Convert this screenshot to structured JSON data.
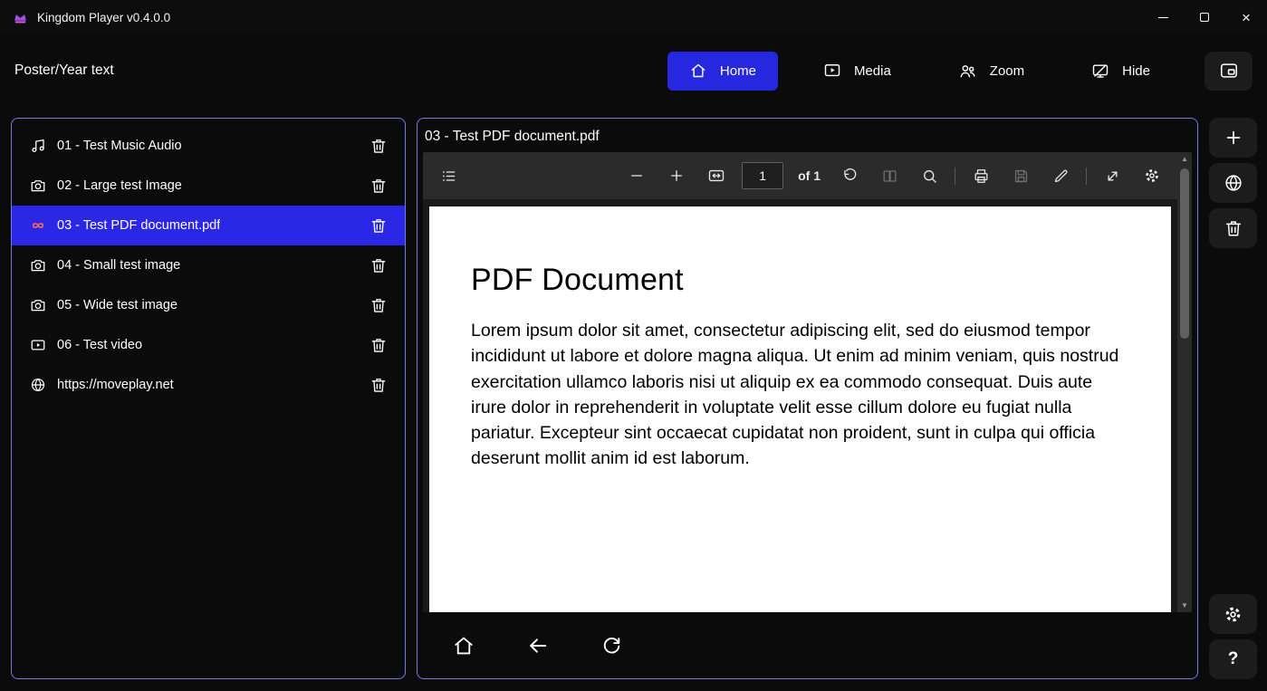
{
  "titlebar": {
    "app_title": "Kingdom Player v0.4.0.0"
  },
  "header": {
    "poster_label": "Poster/Year text",
    "nav": [
      {
        "icon": "home-icon",
        "label": "Home",
        "active": true
      },
      {
        "icon": "media-icon",
        "label": "Media",
        "active": false
      },
      {
        "icon": "zoom-people-icon",
        "label": "Zoom",
        "active": false
      },
      {
        "icon": "hide-display-icon",
        "label": "Hide",
        "active": false
      }
    ]
  },
  "playlist": {
    "items": [
      {
        "icon": "music-note-icon",
        "label": "01 - Test Music Audio",
        "selected": false
      },
      {
        "icon": "camera-icon",
        "label": "02 - Large test Image",
        "selected": false
      },
      {
        "icon": "pdf-icon",
        "label": "03 - Test PDF document.pdf",
        "selected": true
      },
      {
        "icon": "camera-icon",
        "label": "04 - Small test image",
        "selected": false
      },
      {
        "icon": "camera-icon",
        "label": "05 - Wide test image",
        "selected": false
      },
      {
        "icon": "video-icon",
        "label": "06 - Test video",
        "selected": false
      },
      {
        "icon": "globe-icon",
        "label": "https://moveplay.net",
        "selected": false
      }
    ]
  },
  "viewer": {
    "title": "03 - Test PDF document.pdf",
    "toolbar": {
      "page_value": "1",
      "page_count_label": "of 1"
    },
    "pdf": {
      "heading": "PDF Document",
      "body": "Lorem ipsum dolor sit amet, consectetur adipiscing elit, sed do eiusmod tempor incididunt ut labore et dolore magna aliqua. Ut enim ad minim veniam, quis nostrud exercitation ullamco laboris nisi ut aliquip ex ea commodo consequat. Duis aute irure dolor in reprehenderit in voluptate velit esse cillum dolore eu fugiat nulla pariatur. Excepteur sint occaecat cupidatat non proident, sunt in culpa qui officia deserunt mollit anim id est laborum."
    }
  },
  "icons": {
    "close": "×",
    "help": "?",
    "scroll_up": "▲",
    "scroll_down": "▼"
  },
  "colors": {
    "accent_blue": "#2628df",
    "selected_item_blue": "#2a28e6",
    "panel_border": "#7678e8",
    "toolbar_bg": "#2b2b2b",
    "page_bg": "#ffffff"
  }
}
